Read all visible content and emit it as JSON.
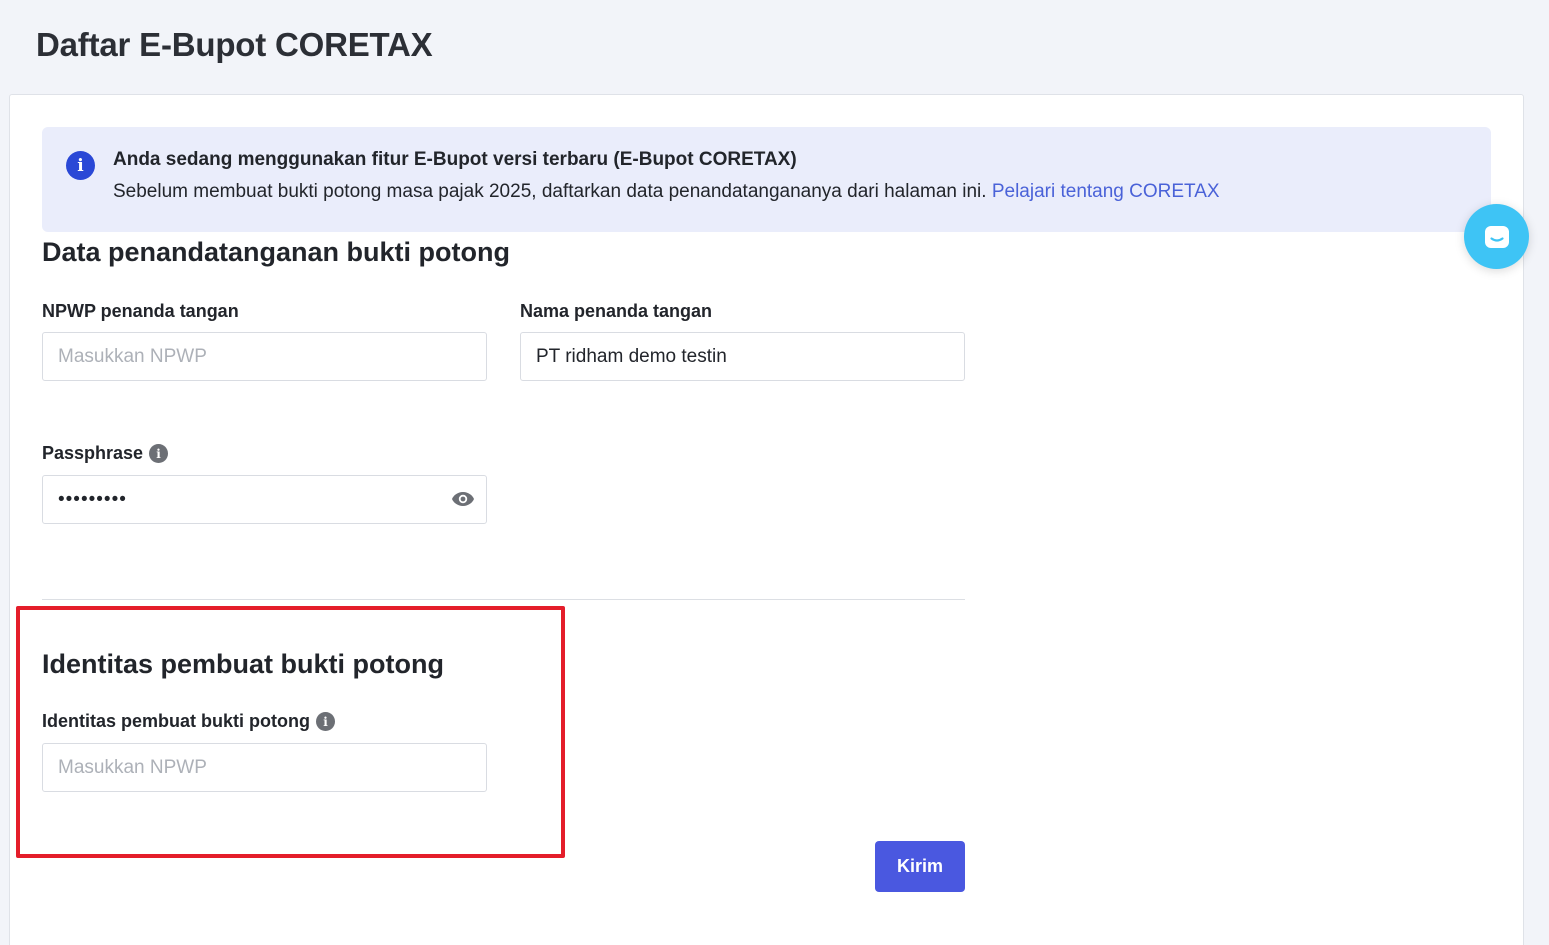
{
  "page": {
    "title": "Daftar E-Bupot CORETAX"
  },
  "alert": {
    "icon": "info-icon",
    "title": "Anda sedang menggunakan fitur E-Bupot versi terbaru (E-Bupot CORETAX)",
    "body": "Sebelum membuat bukti potong masa pajak 2025, daftarkan data penandatangananya dari halaman ini.",
    "link_label": "Pelajari tentang CORETAX"
  },
  "signer_section": {
    "title": "Data penandatanganan bukti potong",
    "npwp": {
      "label": "NPWP penanda tangan",
      "placeholder": "Masukkan NPWP",
      "value": ""
    },
    "name": {
      "label": "Nama penanda tangan",
      "value": "PT ridham demo testin"
    },
    "passphrase": {
      "label": "Passphrase",
      "value": "123456789"
    }
  },
  "creator_section": {
    "title": "Identitas pembuat bukti potong",
    "identity": {
      "label": "Identitas pembuat bukti potong",
      "placeholder": "Masukkan NPWP",
      "value": ""
    }
  },
  "actions": {
    "submit_label": "Kirim"
  },
  "colors": {
    "primary": "#4a58e0",
    "highlight": "#e41d2a",
    "chat": "#3ec4f5",
    "alert_bg": "#eaedfb"
  }
}
